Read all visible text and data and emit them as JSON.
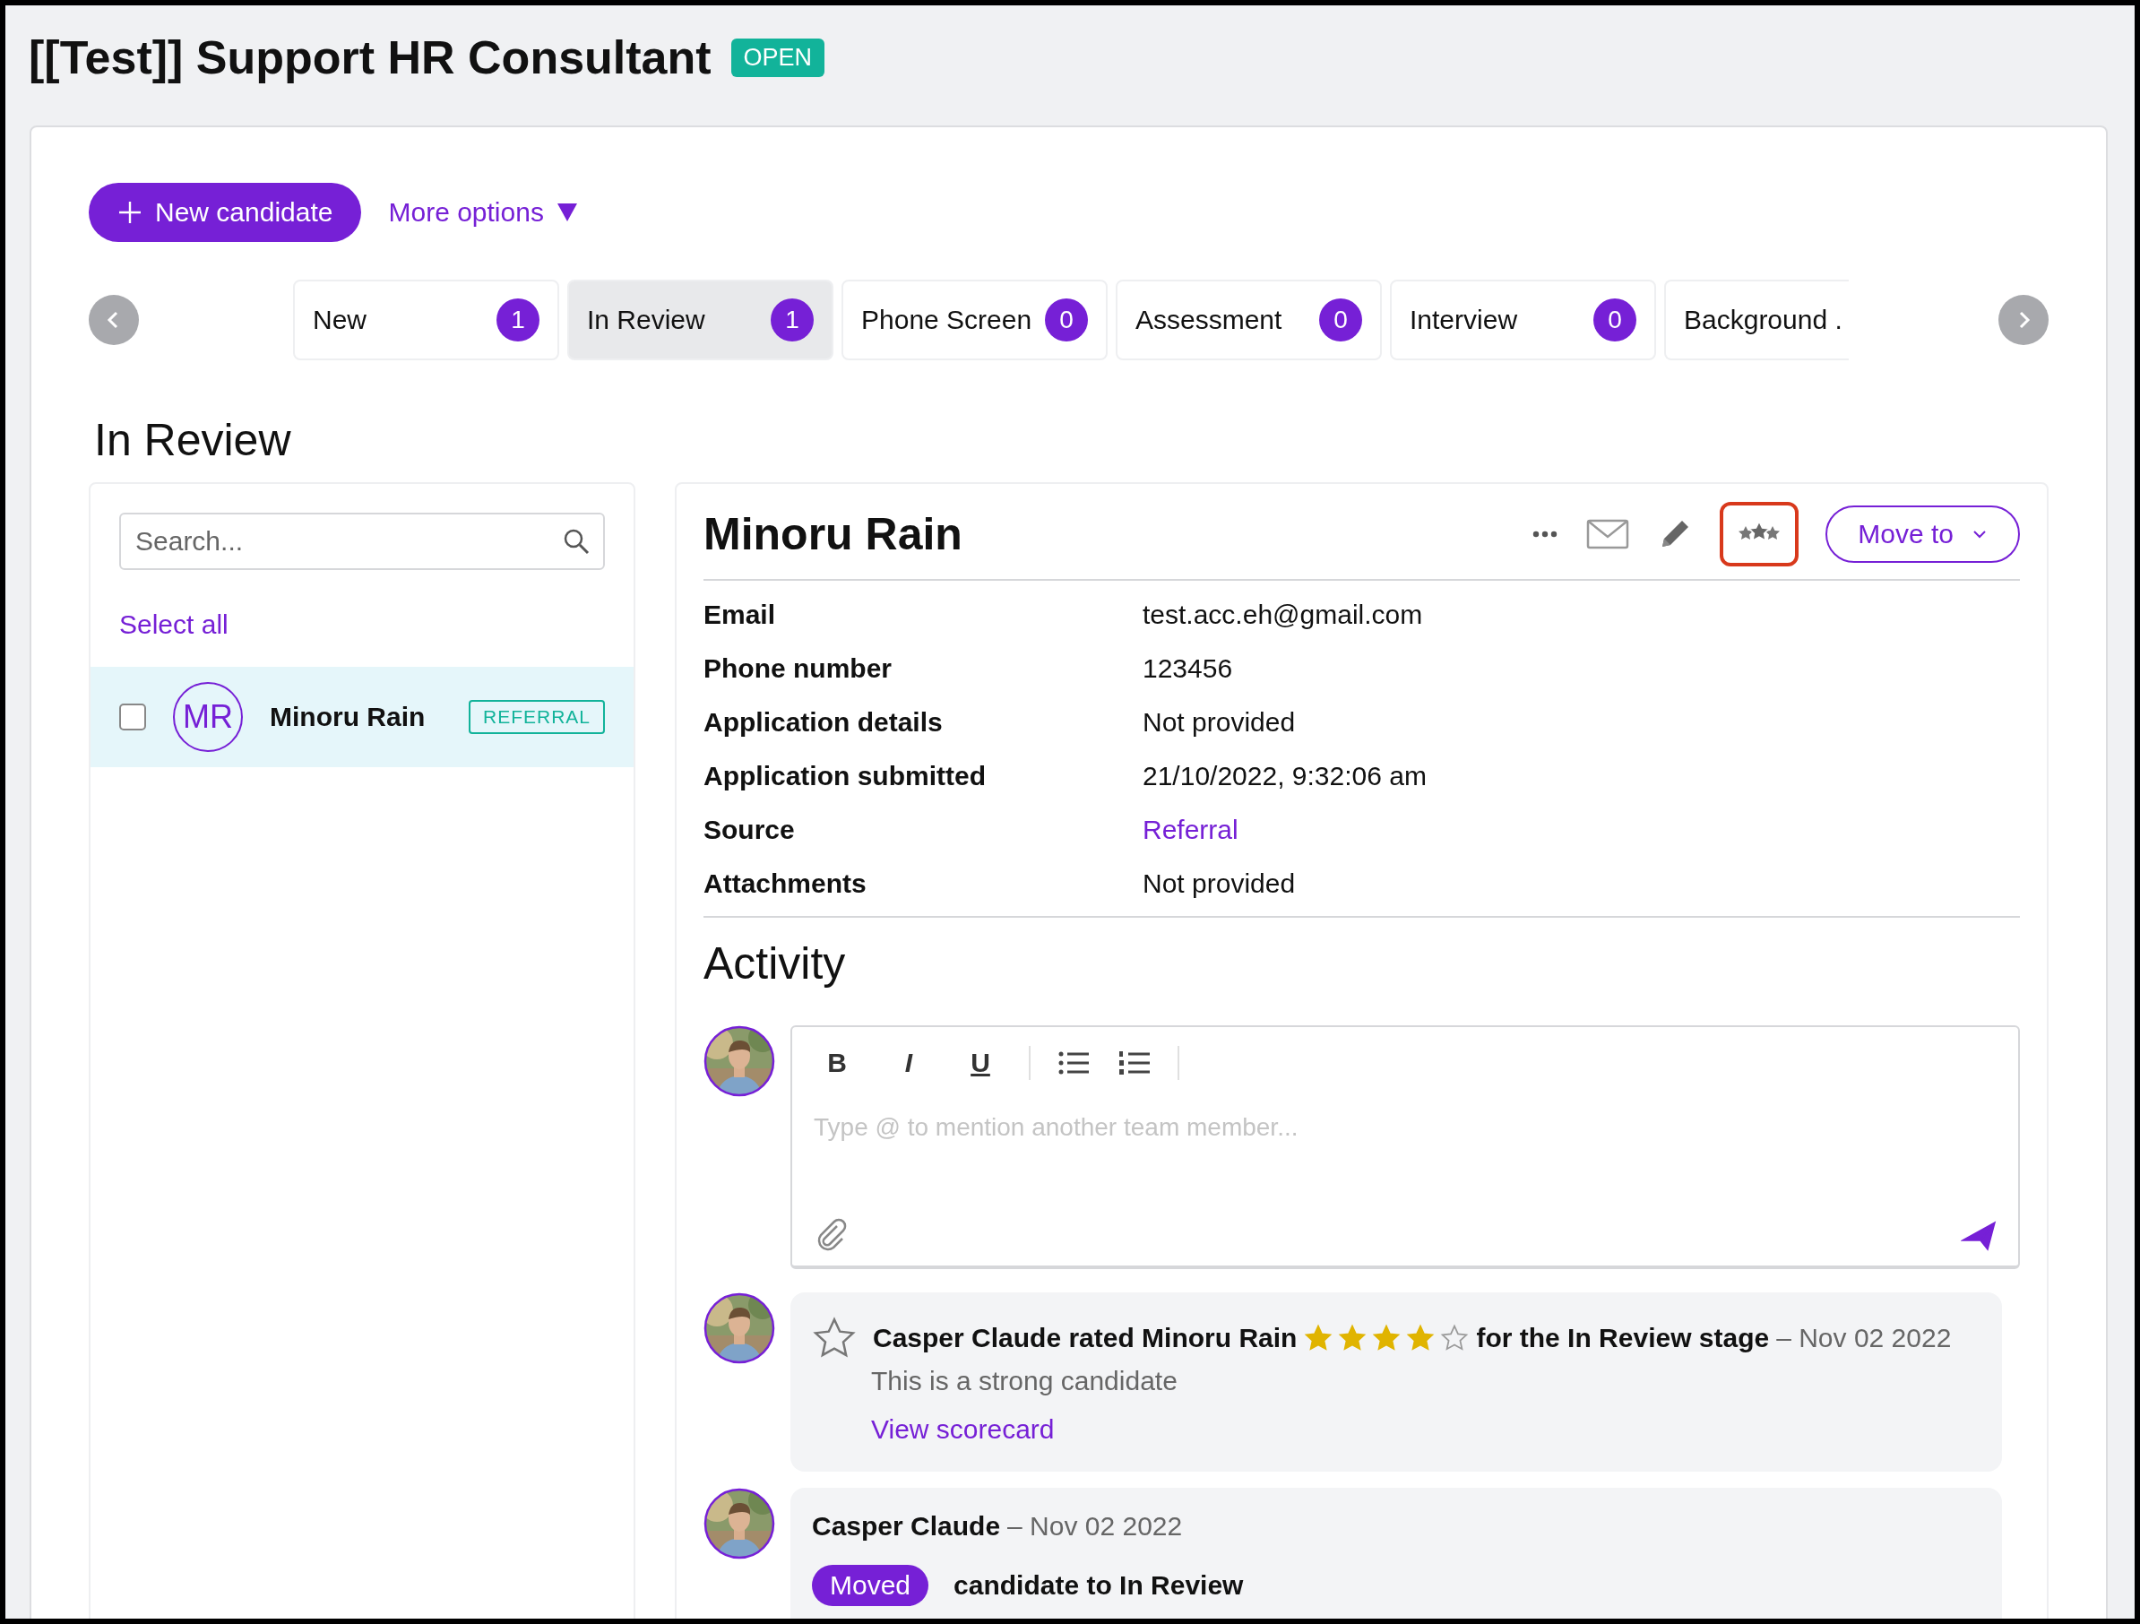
{
  "job": {
    "title": "[[Test]] Support HR Consultant",
    "status": "OPEN"
  },
  "actions": {
    "new_candidate": "New candidate",
    "more_options": "More options"
  },
  "stages": [
    {
      "label": "New",
      "count": "1",
      "selected": false
    },
    {
      "label": "In Review",
      "count": "1",
      "selected": true
    },
    {
      "label": "Phone Screen",
      "count": "0",
      "selected": false
    },
    {
      "label": "Assessment",
      "count": "0",
      "selected": false
    },
    {
      "label": "Interview",
      "count": "0",
      "selected": false
    },
    {
      "label": "Background .",
      "selected": false
    }
  ],
  "stage_heading": "In Review",
  "candidate_list": {
    "search_placeholder": "Search...",
    "select_all": "Select all",
    "candidates": [
      {
        "initials": "MR",
        "name": "Minoru Rain",
        "tag": "REFERRAL",
        "checked": false,
        "selected": true
      }
    ]
  },
  "candidate": {
    "name": "Minoru Rain",
    "rating_button_highlighted": true,
    "move_to": "Move to",
    "details": [
      {
        "label": "Email",
        "value": "test.acc.eh@gmail.com",
        "kind": "text"
      },
      {
        "label": "Phone number",
        "value": "123456",
        "kind": "text"
      },
      {
        "label": "Application details",
        "value": "Not provided",
        "kind": "text"
      },
      {
        "label": "Application submitted",
        "value": "21/10/2022, 9:32:06 am",
        "kind": "text"
      },
      {
        "label": "Source",
        "value": "Referral",
        "kind": "link"
      },
      {
        "label": "Attachments",
        "value": "Not provided",
        "kind": "text"
      }
    ]
  },
  "activity": {
    "heading": "Activity",
    "editor": {
      "format_buttons": [
        "B",
        "I",
        "U"
      ],
      "placeholder": "Type @ to mention another team member..."
    },
    "items": [
      {
        "kind": "rating",
        "headline": "Casper Claude rated Minoru Rain",
        "stars": 4,
        "stage_text": "for the In Review stage",
        "date": "– Nov 02 2022",
        "comment": "This is a strong candidate",
        "link": "View scorecard"
      },
      {
        "kind": "move",
        "author": "Casper Claude",
        "date": "– Nov 02 2022",
        "badge": "Moved",
        "text": "candidate to In Review"
      }
    ]
  }
}
